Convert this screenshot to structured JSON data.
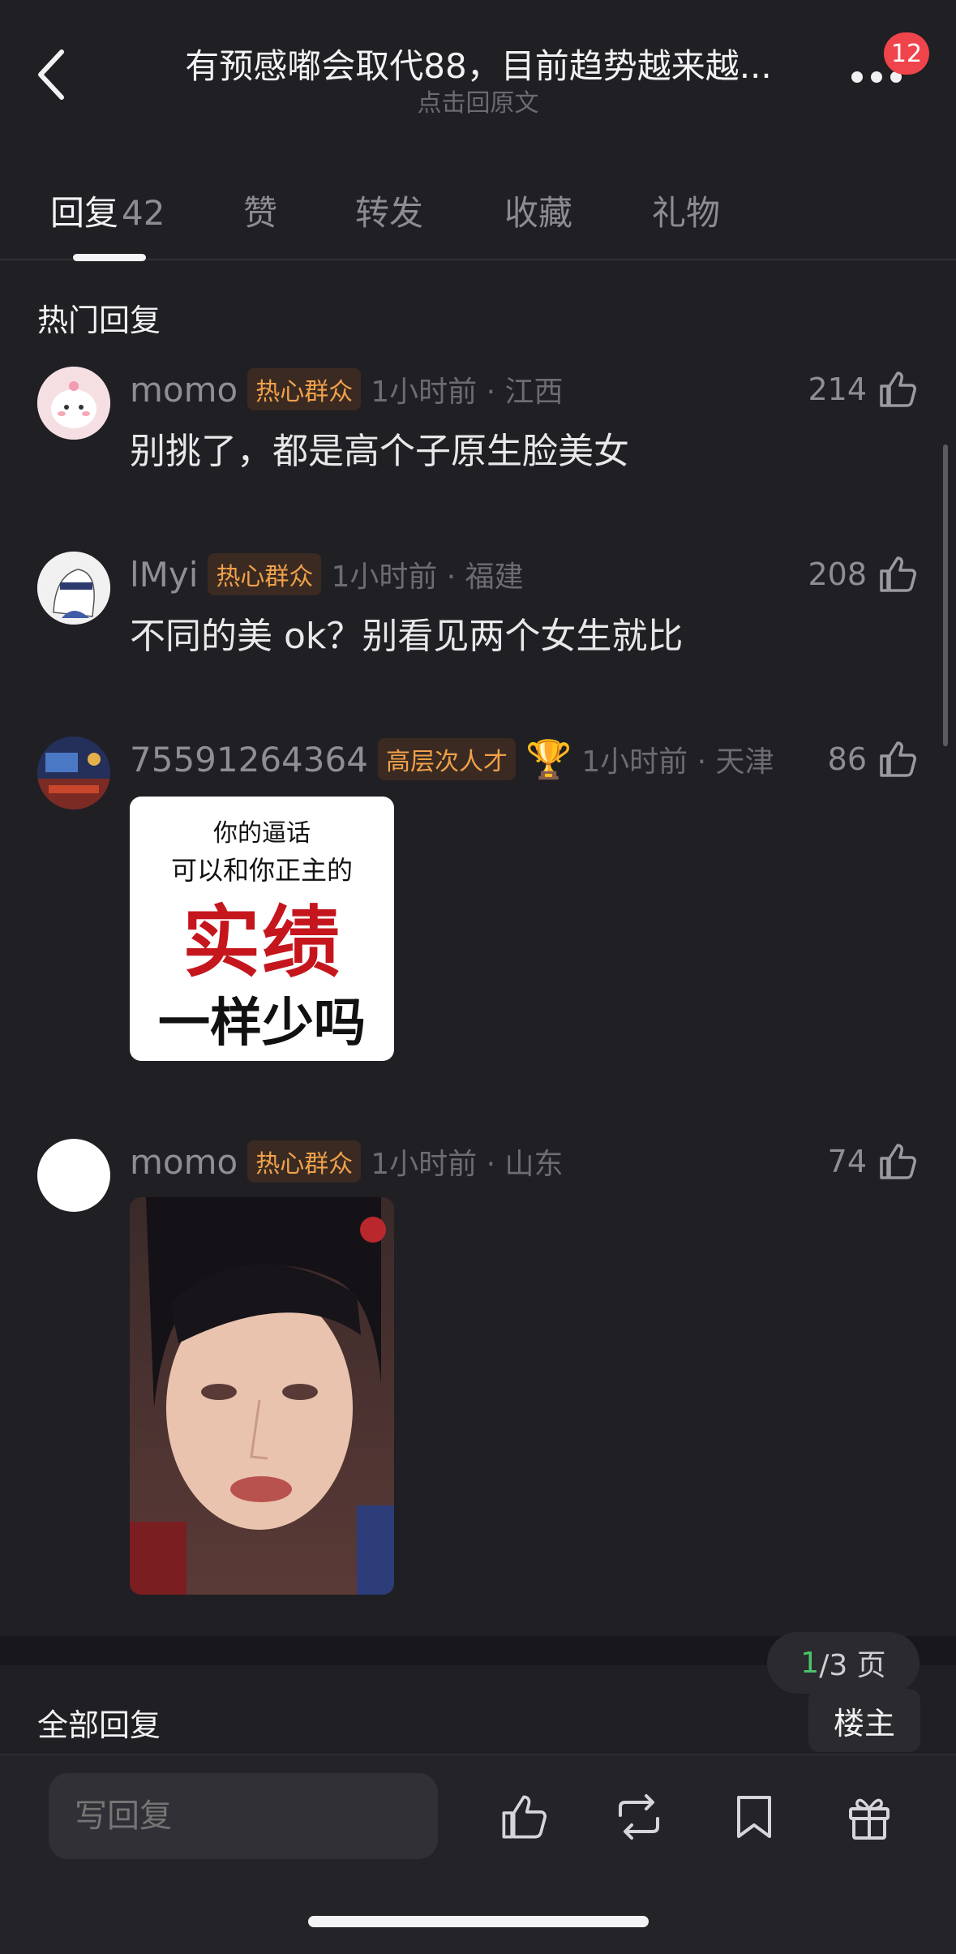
{
  "header": {
    "title": "有预感嘟会取代88，目前趋势越来越...",
    "subtitle": "点击回原文",
    "notification_count": "12"
  },
  "tabs": [
    {
      "label": "回复",
      "count": "42"
    },
    {
      "label": "赞",
      "count": ""
    },
    {
      "label": "转发",
      "count": ""
    },
    {
      "label": "收藏",
      "count": ""
    },
    {
      "label": "礼物",
      "count": ""
    }
  ],
  "hot_section_title": "热门回复",
  "comments": [
    {
      "name": "momo",
      "badge": "热心群众",
      "time": "1小时前 · 江西",
      "likes": "214",
      "text": "别挑了，都是高个子原生脸美女"
    },
    {
      "name": "lMyi",
      "badge": "热心群众",
      "time": "1小时前 · 福建",
      "likes": "208",
      "text": "不同的美 ok？别看见两个女生就比"
    },
    {
      "name": "75591264364",
      "badge": "高层次人才",
      "time": "1小时前 · 天津",
      "likes": "86",
      "meme": {
        "line1": "你的逼话",
        "line2": "可以和你正主的",
        "line3": "实绩",
        "line4": "一样少吗"
      }
    },
    {
      "name": "momo",
      "badge": "热心群众",
      "time": "1小时前 · 山东",
      "likes": "74"
    }
  ],
  "all_section_title": "全部回复",
  "pagination": {
    "current": "1",
    "rest": "/3 页"
  },
  "owner_button": "楼主",
  "bottom_bar": {
    "reply_placeholder": "写回复"
  },
  "colors": {
    "background": "#1f1f24",
    "badge_orange": "#f0a14a",
    "notification_red": "#f0444c",
    "page_green": "#4cc36a"
  }
}
